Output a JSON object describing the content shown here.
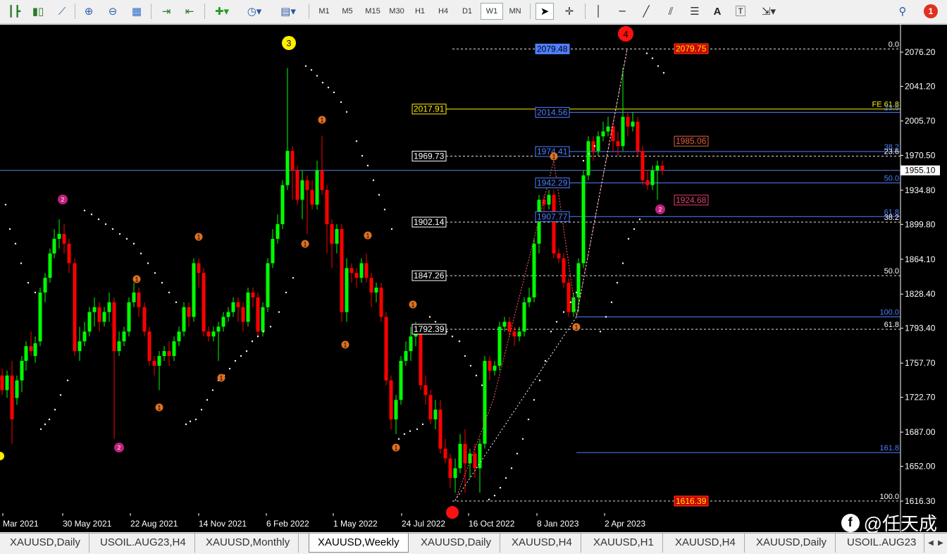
{
  "toolbar": {
    "timeframes": [
      "M1",
      "M5",
      "M15",
      "M30",
      "H1",
      "H4",
      "D1",
      "W1",
      "MN"
    ],
    "active_timeframe": "W1",
    "notification_count": "1"
  },
  "chart": {
    "symbol": "XAUUSD",
    "timeframe": "Weekly",
    "current_price": "1955.10",
    "price_axis": [
      "2076.20",
      "2041.20",
      "2005.70",
      "1970.50",
      "1934.80",
      "1899.80",
      "1864.10",
      "1828.40",
      "1793.40",
      "1757.70",
      "1722.70",
      "1687.00",
      "1652.00",
      "1616.30"
    ],
    "time_axis": [
      "Mar 2021",
      "30 May 2021",
      "22 Aug 2021",
      "14 Nov 2021",
      "6 Feb 2022",
      "1 May 2022",
      "24 Jul 2022",
      "16 Oct 2022",
      "8 Jan 2023",
      "2 Apr 2023"
    ],
    "wave_labels": [
      "3",
      "4",
      "2",
      "2",
      "2"
    ],
    "small_wave_labels": [
      "1",
      "1",
      "1",
      "1",
      "1",
      "1",
      "1",
      "1",
      "1",
      "1",
      "1",
      "1",
      "1",
      "1"
    ],
    "price_labels": [
      "2079.48",
      "2079.75",
      "2017.91",
      "2014.56",
      "1985.06",
      "1969.73",
      "1974.41",
      "1942.29",
      "1924.68",
      "1907.77",
      "1902.14",
      "1847.26",
      "1792.39",
      "1616.39"
    ],
    "fib_right_top": [
      "0.0",
      "FE 61.8",
      "23.6",
      "38.2",
      "23.6",
      "50.0",
      "61.8",
      "38.2"
    ],
    "fib_right_bottom": [
      "50.0",
      "100.0",
      "61.8",
      "161.8",
      "100.0"
    ]
  },
  "watermark": {
    "text": "@任天成"
  },
  "tabs": [
    "XAUUSD,Daily",
    "USOIL.AUG23,H4",
    "XAUUSD,Monthly",
    "XAUUSD,Weekly",
    "XAUUSD,Daily",
    "XAUUSD,H4",
    "XAUUSD,H1",
    "XAUUSD,H4",
    "XAUUSD,Daily",
    "USOIL.AUG23"
  ],
  "active_tab": "XAUUSD,Weekly",
  "colors": {
    "bull": "#00ff00",
    "bear": "#ff0000",
    "background": "#000000",
    "sar": "#ffffff",
    "fib_blue": "#4f7fff",
    "label_yellow": "#ffee00",
    "wave_red": "#ff1010",
    "wave_magenta": "#c0207f",
    "wave_orange": "#e07020"
  }
}
